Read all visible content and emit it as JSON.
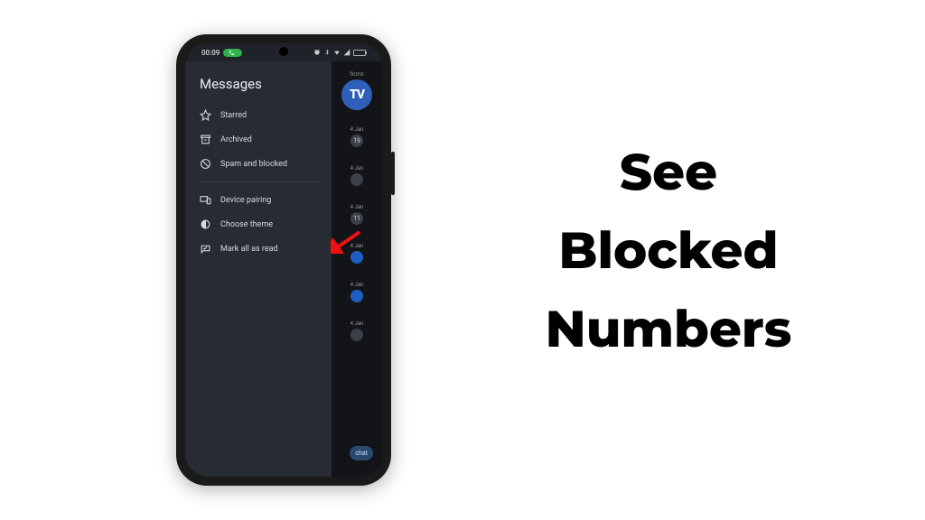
{
  "caption": {
    "line1": "See",
    "line2": "Blocked",
    "line3": "Numbers"
  },
  "statusbar": {
    "time": "00:09",
    "pill": ""
  },
  "drawer": {
    "title": "Messages",
    "items": [
      {
        "label": "Starred",
        "icon": "star-icon"
      },
      {
        "label": "Archived",
        "icon": "archive-icon"
      },
      {
        "label": "Spam and blocked",
        "icon": "block-icon"
      }
    ],
    "items2": [
      {
        "label": "Device pairing",
        "icon": "devices-icon"
      },
      {
        "label": "Choose theme",
        "icon": "theme-icon"
      },
      {
        "label": "Mark all as read",
        "icon": "read-icon"
      }
    ]
  },
  "conversations": {
    "first_label": "tions",
    "avatar_text": "TV",
    "entries": [
      {
        "date": "4 Jan",
        "badge": "19"
      },
      {
        "date": "4 Jan",
        "badge": ""
      },
      {
        "date": "4 Jan",
        "badge": "11"
      },
      {
        "date": "4 Jan",
        "badge": "",
        "blue": true
      },
      {
        "date": "4 Jan",
        "badge": "",
        "blue": true
      },
      {
        "date": "4 Jan",
        "badge": ""
      }
    ],
    "chat_label": "chat"
  }
}
